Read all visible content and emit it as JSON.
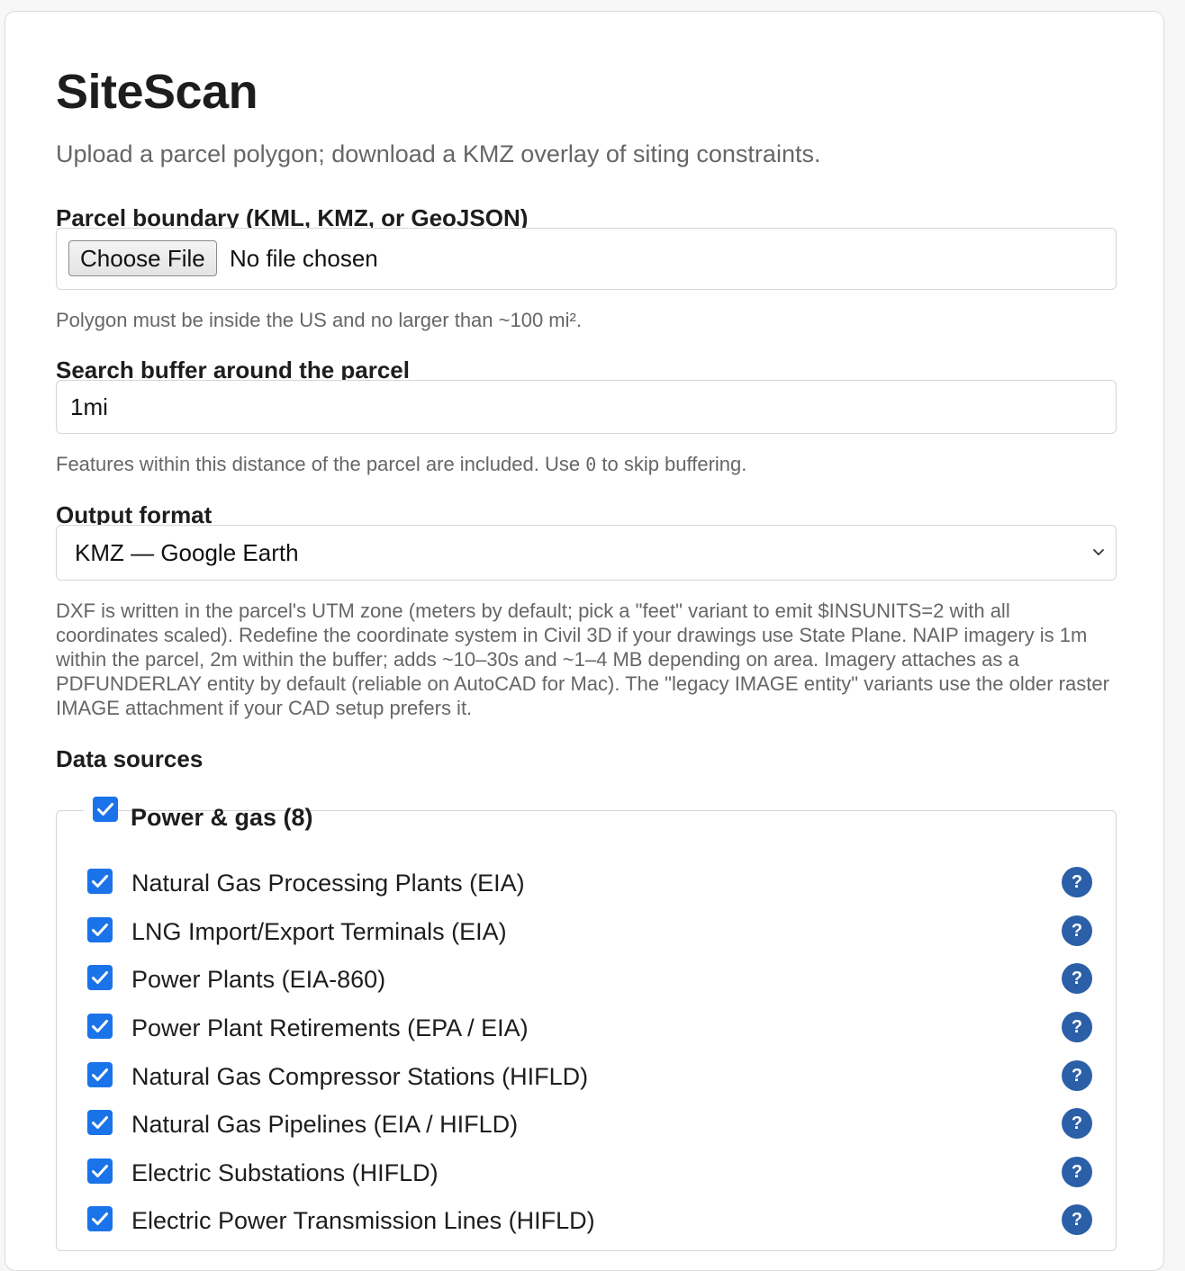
{
  "app": {
    "title": "SiteScan",
    "subtitle": "Upload a parcel polygon; download a KMZ overlay of siting constraints."
  },
  "parcel": {
    "label": "Parcel boundary (KML, KMZ, or GeoJSON)",
    "button_label": "Choose File",
    "status": "No file chosen",
    "help": "Polygon must be inside the US and no larger than ~100 mi²."
  },
  "buffer": {
    "label": "Search buffer around the parcel",
    "value": "1mi",
    "help_before": "Features within this distance of the parcel are included. Use ",
    "help_code": "0",
    "help_after": " to skip buffering."
  },
  "output": {
    "label": "Output format",
    "selected": "KMZ — Google Earth",
    "help": "DXF is written in the parcel's UTM zone (meters by default; pick a \"feet\" variant to emit $INSUNITS=2 with all coordinates scaled). Redefine the coordinate system in Civil 3D if your drawings use State Plane. NAIP imagery is 1m within the parcel, 2m within the buffer; adds ~10–30s and ~1–4 MB depending on area. Imagery attaches as a PDFUNDERLAY entity by default (reliable on AutoCAD for Mac). The \"legacy IMAGE entity\" variants use the older raster IMAGE attachment if your CAD setup prefers it."
  },
  "sources": {
    "label": "Data sources",
    "group": {
      "title": "Power & gas (8)",
      "checked": true,
      "items": [
        {
          "label": "Natural Gas Processing Plants (EIA)",
          "checked": true,
          "help_glyph": "?"
        },
        {
          "label": "LNG Import/Export Terminals (EIA)",
          "checked": true,
          "help_glyph": "?"
        },
        {
          "label": "Power Plants (EIA-860)",
          "checked": true,
          "help_glyph": "?"
        },
        {
          "label": "Power Plant Retirements (EPA / EIA)",
          "checked": true,
          "help_glyph": "?"
        },
        {
          "label": "Natural Gas Compressor Stations (HIFLD)",
          "checked": true,
          "help_glyph": "?"
        },
        {
          "label": "Natural Gas Pipelines (EIA / HIFLD)",
          "checked": true,
          "help_glyph": "?"
        },
        {
          "label": "Electric Substations (HIFLD)",
          "checked": true,
          "help_glyph": "?"
        },
        {
          "label": "Electric Power Transmission Lines (HIFLD)",
          "checked": true,
          "help_glyph": "?"
        }
      ]
    }
  },
  "colors": {
    "checkbox": "#1a73e8",
    "help_badge": "#2b5fa8",
    "muted_text": "#666666"
  }
}
